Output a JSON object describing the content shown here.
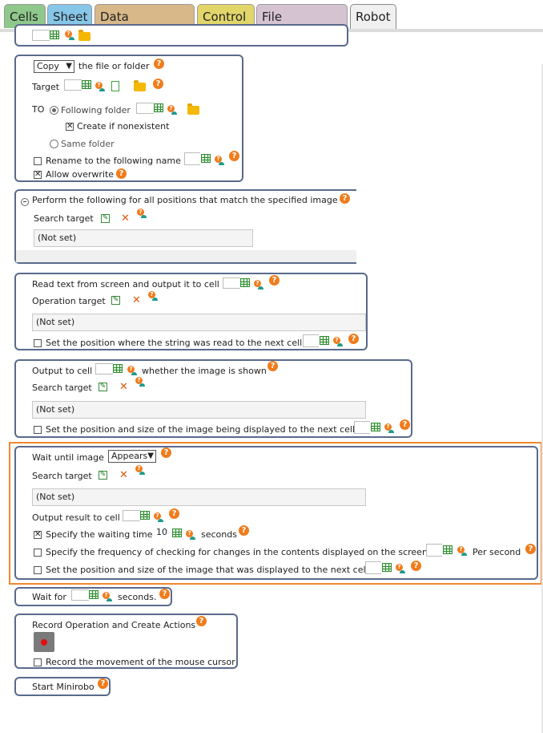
{
  "tabs": [
    {
      "label": "Cells",
      "color": "#8fc88b"
    },
    {
      "label": "Sheet",
      "color": "#86c6e8"
    },
    {
      "label": "Data operation",
      "color": "#d8b888"
    },
    {
      "label": "Control",
      "color": "#e2d56a"
    },
    {
      "label": "File operation",
      "color": "#d6c3d2"
    },
    {
      "label": "Robot",
      "color": "#f0f0f0"
    }
  ],
  "copy": {
    "mode": "Copy",
    "title": "the file or folder",
    "target_label": "Target",
    "to_label": "TO",
    "following_folder": "Following folder",
    "create_if_nonexistent": "Create if nonexistent",
    "same_folder": "Same folder",
    "rename_label": "Rename to the following name",
    "allow_overwrite": "Allow overwrite"
  },
  "perform": {
    "title": "Perform the following for all positions that match the specified image",
    "search_target": "Search target",
    "value": "(Not set)"
  },
  "readtext": {
    "title": "Read text from screen and output it to cell",
    "operation_target": "Operation target",
    "value": "(Not set)",
    "set_position": "Set the position where the string was read to the next cell"
  },
  "output_image": {
    "title_a": "Output to cell",
    "title_b": "whether the image is shown",
    "search_target": "Search target",
    "value": "(Not set)",
    "set_position": "Set the position and size of the image being displayed to the next cell"
  },
  "wait_image": {
    "title": "Wait until image",
    "mode": "Appears",
    "search_target": "Search target",
    "value": "(Not set)",
    "output_result": "Output result to cell",
    "specify_waiting": "Specify the waiting time",
    "waiting_value": "10",
    "seconds": "seconds",
    "specify_frequency": "Specify the frequency of checking for changes in the contents displayed on the screen",
    "per_second": "Per second",
    "set_position": "Set the position and size of the image that was displayed to the next cell"
  },
  "wait_for": {
    "label_a": "Wait for",
    "label_b": "seconds."
  },
  "record": {
    "title": "Record Operation and Create Actions",
    "record_mouse": "Record the movement of the mouse cursor"
  },
  "minirobo": {
    "title": "Start Minirobo"
  },
  "icons": {
    "help": "?",
    "close": "✕",
    "check": "✕"
  }
}
